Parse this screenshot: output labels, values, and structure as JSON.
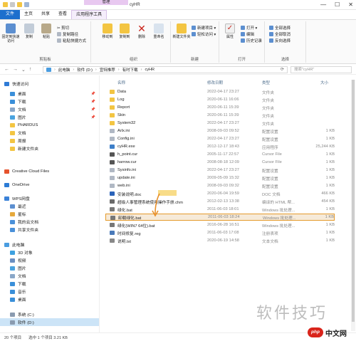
{
  "titlebar": {
    "context_tab": "管理",
    "window_title": "cyHR",
    "minimize": "—",
    "maximize": "☐",
    "close": "✕"
  },
  "ribbon_tabs": [
    "文件",
    "主页",
    "共享",
    "查看",
    "应用程序工具"
  ],
  "ribbon": {
    "clipboard": {
      "label": "剪贴板",
      "pin": "固定到快速访问",
      "copy": "复制",
      "paste": "粘贴",
      "cut": "✂ 剪切",
      "copy_path": "复制路径",
      "paste_shortcut": "粘贴快捷方式"
    },
    "organize": {
      "label": "组织",
      "move_to": "移动到",
      "copy_to": "复制到",
      "delete": "删除",
      "rename": "重命名"
    },
    "new": {
      "label": "新建",
      "new_folder": "新建文件夹",
      "new_item": "新建项目 ▾",
      "easy_access": "轻松访问 ▾"
    },
    "open": {
      "label": "打开",
      "properties": "属性",
      "open": "打开 ▾",
      "edit": "编辑",
      "history": "历史记录"
    },
    "select": {
      "label": "选择",
      "select_all": "全部选择",
      "select_none": "全部取消",
      "invert": "反向选择"
    }
  },
  "addressbar": {
    "crumbs": [
      "此电脑",
      "软件 (D:)",
      "宜特推荐",
      "有时下载",
      "cyHR"
    ],
    "search_placeholder": "搜索\"cyHR\""
  },
  "sidebar": [
    {
      "label": "快速访问",
      "icon": "star-icon",
      "color": "#2f7bd6",
      "pinned": false,
      "indent": 0
    },
    {
      "label": "桌面",
      "icon": "desktop-icon",
      "color": "#3a8fd9",
      "pinned": true,
      "indent": 1
    },
    {
      "label": "下载",
      "icon": "download-icon",
      "color": "#3a8fd9",
      "pinned": true,
      "indent": 1
    },
    {
      "label": "文档",
      "icon": "document-icon",
      "color": "#8aa7c8",
      "pinned": true,
      "indent": 1
    },
    {
      "label": "图片",
      "icon": "picture-icon",
      "color": "#4aa3df",
      "pinned": true,
      "indent": 1
    },
    {
      "label": "PHARDUS",
      "icon": "folder-icon",
      "color": "#f3c542",
      "pinned": false,
      "indent": 1
    },
    {
      "label": "文档",
      "icon": "folder-icon",
      "color": "#f3c542",
      "pinned": false,
      "indent": 1
    },
    {
      "label": "周报",
      "icon": "folder-icon",
      "color": "#f3c542",
      "pinned": false,
      "indent": 1
    },
    {
      "label": "新建文件夹",
      "icon": "folder-icon",
      "color": "#f3c542",
      "pinned": false,
      "indent": 1
    },
    {
      "label": "Creative Cloud Files",
      "icon": "creative-cloud-icon",
      "color": "#e5532d",
      "pinned": false,
      "indent": 0
    },
    {
      "label": "OneDrive",
      "icon": "cloud-icon",
      "color": "#2c7bd5",
      "pinned": false,
      "indent": 0
    },
    {
      "label": "WPS网盘",
      "icon": "cloud-icon",
      "color": "#3b82d8",
      "pinned": false,
      "indent": 0
    },
    {
      "label": "最近",
      "icon": "clock-icon",
      "color": "#5c8fd0",
      "pinned": false,
      "indent": 1
    },
    {
      "label": "星标",
      "icon": "star-icon",
      "color": "#e6a93c",
      "pinned": false,
      "indent": 1
    },
    {
      "label": "我的云文档",
      "icon": "cloud-icon",
      "color": "#4a90d9",
      "pinned": false,
      "indent": 1
    },
    {
      "label": "共享文件夹",
      "icon": "share-icon",
      "color": "#4a90d9",
      "pinned": false,
      "indent": 1
    },
    {
      "label": "此电脑",
      "icon": "computer-icon",
      "color": "#4a9de0",
      "pinned": false,
      "indent": 0
    },
    {
      "label": "3D 对象",
      "icon": "cube-icon",
      "color": "#3ea1e0",
      "pinned": false,
      "indent": 1
    },
    {
      "label": "视频",
      "icon": "video-icon",
      "color": "#6b8fc1",
      "pinned": false,
      "indent": 1
    },
    {
      "label": "图片",
      "icon": "picture-icon",
      "color": "#4aa3df",
      "pinned": false,
      "indent": 1
    },
    {
      "label": "文档",
      "icon": "document-icon",
      "color": "#8aa7c8",
      "pinned": false,
      "indent": 1
    },
    {
      "label": "下载",
      "icon": "download-icon",
      "color": "#3a8fd9",
      "pinned": false,
      "indent": 1
    },
    {
      "label": "音乐",
      "icon": "music-icon",
      "color": "#3a8fd9",
      "pinned": false,
      "indent": 1
    },
    {
      "label": "桌面",
      "icon": "desktop-icon",
      "color": "#3a8fd9",
      "pinned": false,
      "indent": 1
    },
    {
      "label": "系统 (C:)",
      "icon": "drive-icon",
      "color": "#8a9bb0",
      "pinned": false,
      "indent": 1
    },
    {
      "label": "软件 (D:)",
      "icon": "drive-icon",
      "color": "#8a9bb0",
      "pinned": false,
      "indent": 1
    }
  ],
  "columns": {
    "name": "名称",
    "date": "修改日期",
    "type": "类型",
    "size": "大小"
  },
  "files": [
    {
      "name": "Data",
      "date": "2022-04-17 23:27",
      "type": "文件夹",
      "size": "",
      "color": "#f3c542",
      "icon": "folder-icon"
    },
    {
      "name": "Log",
      "date": "2020-06-11 16:06",
      "type": "文件夹",
      "size": "",
      "color": "#f3c542",
      "icon": "folder-icon"
    },
    {
      "name": "Report",
      "date": "2020-06-11 15:39",
      "type": "文件夹",
      "size": "",
      "color": "#f3c542",
      "icon": "folder-icon"
    },
    {
      "name": "Skin",
      "date": "2020-06-11 15:39",
      "type": "文件夹",
      "size": "",
      "color": "#f3c542",
      "icon": "folder-icon"
    },
    {
      "name": "System32",
      "date": "2022-04-17 23:27",
      "type": "文件夹",
      "size": "",
      "color": "#f3c542",
      "icon": "folder-icon"
    },
    {
      "name": "Arlx.ini",
      "date": "2008-09-03 09:52",
      "type": "配置设置",
      "size": "1 KB",
      "color": "#b0b8c4",
      "icon": "settings-file-icon"
    },
    {
      "name": "Config.ini",
      "date": "2022-04-17 23:27",
      "type": "配置设置",
      "size": "1 KB",
      "color": "#b0b8c4",
      "icon": "settings-file-icon"
    },
    {
      "name": "cyHR.exe",
      "date": "2012-12-17 18:43",
      "type": "应用程序",
      "size": "25,244 KB",
      "color": "#3d7fc9",
      "icon": "application-icon"
    },
    {
      "name": "h_point.cur",
      "date": "2005-11-17 22:57",
      "type": "Cursor File",
      "size": "1 KB",
      "color": "#555",
      "icon": "cursor-file-icon"
    },
    {
      "name": "harrow.cur",
      "date": "2008-08-18 12:09",
      "type": "Cursor File",
      "size": "1 KB",
      "color": "#555",
      "icon": "cursor-file-icon"
    },
    {
      "name": "Sysinfo.ini",
      "date": "2022-04-17 23:27",
      "type": "配置设置",
      "size": "1 KB",
      "color": "#b0b8c4",
      "icon": "settings-file-icon"
    },
    {
      "name": "update.ini",
      "date": "2009-05-09 15:32",
      "type": "配置设置",
      "size": "1 KB",
      "color": "#b0b8c4",
      "icon": "settings-file-icon"
    },
    {
      "name": "web.ini",
      "date": "2008-09-03 09:32",
      "type": "配置设置",
      "size": "1 KB",
      "color": "#b0b8c4",
      "icon": "settings-file-icon"
    },
    {
      "name": "安装说明.doc",
      "date": "2020-06-04 19:59",
      "type": "DOC 文档",
      "size": "466 KB",
      "color": "#2b63b9",
      "icon": "word-doc-icon"
    },
    {
      "name": "超级人事管理系统使用操作手册.chm",
      "date": "2012-02-13 13:38",
      "type": "编译的 HTML 帮...",
      "size": "454 KB",
      "color": "#6a6a6a",
      "icon": "help-file-icon"
    },
    {
      "name": "绿化.bat",
      "date": "2011-06-03 18:01",
      "type": "Windows 批处理...",
      "size": "1 KB",
      "color": "#777",
      "icon": "batch-file-icon"
    },
    {
      "name": "卸载绿化.bat",
      "date": "2011-06-03 18:24",
      "type": "Windows 批处理...",
      "size": "1 KB",
      "color": "#777",
      "icon": "batch-file-icon"
    },
    {
      "name": "绿化(WIN7 64位).bat",
      "date": "2016-06-28 16:51",
      "type": "Windows 批处理...",
      "size": "1 KB",
      "color": "#777",
      "icon": "batch-file-icon"
    },
    {
      "name": "时间修复.reg",
      "date": "2011-06-03 17:08",
      "type": "注册表项",
      "size": "1 KB",
      "color": "#4a7ab9",
      "icon": "registry-file-icon"
    },
    {
      "name": "说明.txt",
      "date": "2020-06-19 14:58",
      "type": "文本文档",
      "size": "1 KB",
      "color": "#888",
      "icon": "text-file-icon"
    }
  ],
  "status": {
    "items": "20 个项目",
    "selected": "选中 1 个项目  3.21 KB"
  },
  "watermark": "软件技巧",
  "logo": {
    "php": "php",
    "cn": "中文网"
  }
}
